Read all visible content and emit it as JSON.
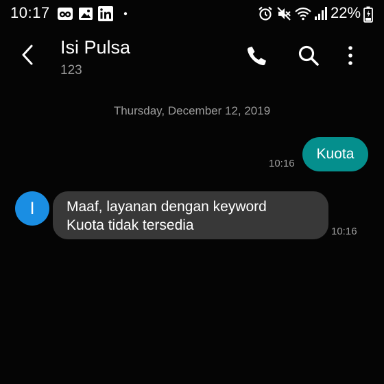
{
  "status_bar": {
    "time": "10:17",
    "battery_percent": "22%",
    "icons": [
      "tripadvisor-icon",
      "gallery-icon",
      "linkedin-icon",
      "notification-dot-icon",
      "alarm-icon",
      "mute-icon",
      "wifi-icon",
      "signal-icon",
      "battery-icon"
    ]
  },
  "header": {
    "title": "Isi Pulsa",
    "subtitle": "123",
    "actions": [
      "phone-icon",
      "search-icon",
      "more-options-icon"
    ]
  },
  "conversation": {
    "date": "Thursday, December 12, 2019",
    "messages": [
      {
        "direction": "sent",
        "text": "Kuota",
        "time": "10:16"
      },
      {
        "direction": "received",
        "avatar_initial": "I",
        "lines": [
          "Maaf, layanan dengan keyword",
          "Kuota tidak tersedia"
        ],
        "time": "10:16"
      }
    ]
  },
  "colors": {
    "background": "#050505",
    "sent_bubble": "#058f8d",
    "received_bubble": "#383838",
    "avatar": "#1a8ee3",
    "secondary_text": "#9c9c9c"
  }
}
